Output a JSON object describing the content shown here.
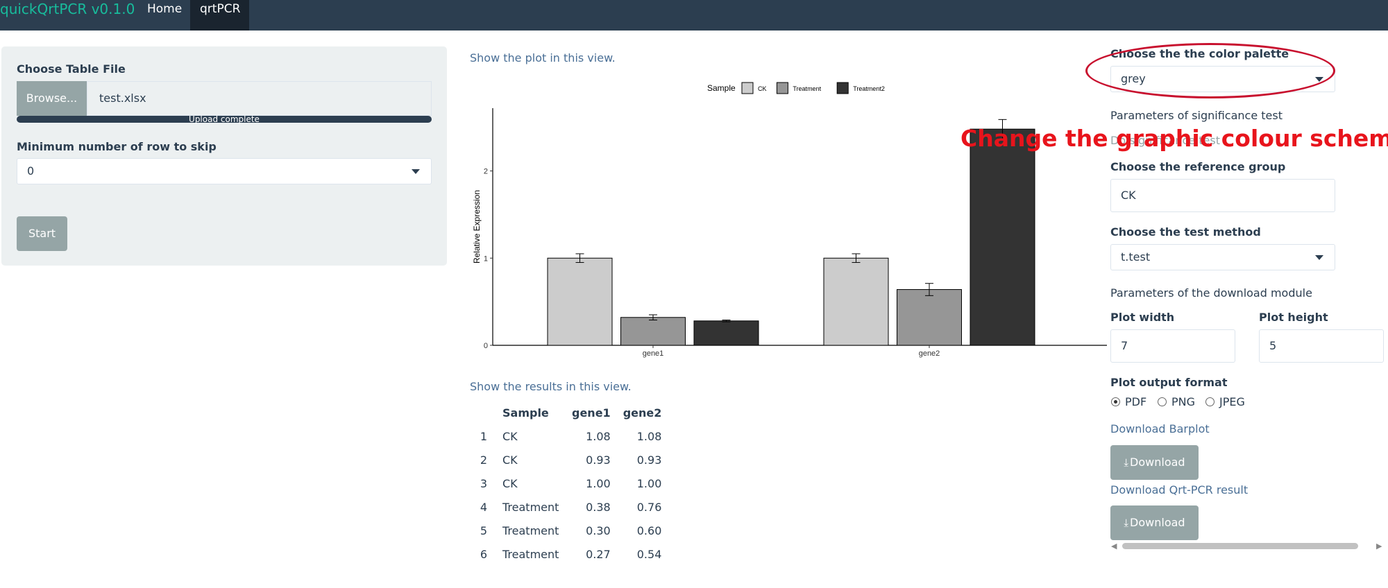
{
  "navbar": {
    "brand": "quickQrtPCR v0.1.0",
    "tabs": [
      {
        "label": "Home",
        "active": false
      },
      {
        "label": "qrtPCR",
        "active": true
      }
    ]
  },
  "sidebar": {
    "file_label": "Choose Table File",
    "browse_label": "Browse...",
    "file_name": "test.xlsx",
    "progress_text": "Upload complete",
    "skip_label": "Minimum number of row to skip",
    "skip_value": "0",
    "start_label": "Start"
  },
  "main": {
    "plot_caption": "Show the plot in this view.",
    "results_caption": "Show the results in this view.",
    "table": {
      "headers": [
        "",
        "Sample",
        "gene1",
        "gene2"
      ],
      "rows": [
        [
          "1",
          "CK",
          "1.08",
          "1.08"
        ],
        [
          "2",
          "CK",
          "0.93",
          "0.93"
        ],
        [
          "3",
          "CK",
          "1.00",
          "1.00"
        ],
        [
          "4",
          "Treatment",
          "0.38",
          "0.76"
        ],
        [
          "5",
          "Treatment",
          "0.30",
          "0.60"
        ],
        [
          "6",
          "Treatment",
          "0.27",
          "0.54"
        ]
      ]
    }
  },
  "chart_data": {
    "type": "bar",
    "categories": [
      "gene1",
      "gene2"
    ],
    "legend_title": "Sample",
    "legend_position": "top",
    "ylabel": "Relative Expression",
    "xlabel": "",
    "ylim": [
      0,
      2.72
    ],
    "yticks": [
      0,
      1,
      2
    ],
    "series": [
      {
        "name": "CK",
        "color": "#cccccc",
        "values": [
          1.0,
          1.0
        ],
        "errors": [
          0.05,
          0.05
        ]
      },
      {
        "name": "Treatment",
        "color": "#969696",
        "values": [
          0.32,
          0.64
        ],
        "errors": [
          0.03,
          0.07
        ]
      },
      {
        "name": "Treatment2",
        "color": "#333333",
        "values": [
          0.28,
          2.48
        ],
        "errors": [
          0.01,
          0.11
        ]
      }
    ]
  },
  "right": {
    "palette_label": "Choose the the color palette",
    "palette_value": "grey",
    "sig_params_label": "Parameters of significance test",
    "sig_checkbox_label": "Do significance test",
    "ref_group_label": "Choose the reference group",
    "ref_group_value": "CK",
    "test_method_label": "Choose the test method",
    "test_method_value": "t.test",
    "download_params_label": "Parameters of the download module",
    "plot_width_label": "Plot width",
    "plot_width_value": "7",
    "plot_height_label": "Plot height",
    "plot_height_value": "5",
    "format_label": "Plot output format",
    "formats": [
      {
        "label": "PDF",
        "selected": true
      },
      {
        "label": "PNG",
        "selected": false
      },
      {
        "label": "JPEG",
        "selected": false
      }
    ],
    "download_barplot_label": "Download Barplot",
    "download_label": "Download",
    "download_result_label": "Download Qrt-PCR result"
  },
  "annotation": {
    "text": "Change the graphic colour scheme",
    "color": "#e8141c"
  }
}
